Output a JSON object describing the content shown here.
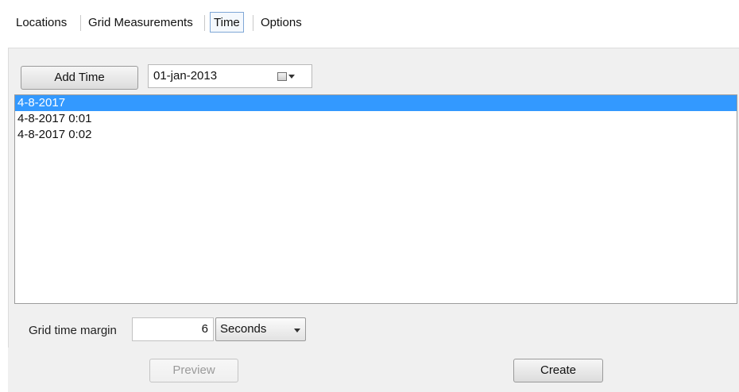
{
  "tabs": [
    {
      "label": "Locations"
    },
    {
      "label": "Grid Measurements"
    },
    {
      "label": "Time"
    },
    {
      "label": "Options"
    }
  ],
  "active_tab": "Time",
  "toolbar": {
    "add_time_label": "Add Time",
    "date_value": "01-jan-2013",
    "date_icon": "calendar-icon"
  },
  "time_list": {
    "items": [
      {
        "label": "4-8-2017",
        "selected": true
      },
      {
        "label": "4-8-2017 0:01",
        "selected": false
      },
      {
        "label": "4-8-2017 0:02",
        "selected": false
      }
    ]
  },
  "margin": {
    "label": "Grid time margin",
    "value": "6",
    "unit_selected": "Seconds"
  },
  "footer": {
    "preview_label": "Preview",
    "create_label": "Create"
  },
  "colors": {
    "selection": "#3399ff",
    "panel": "#f0f0f0",
    "active_tab_border": "#7fa7d6"
  }
}
